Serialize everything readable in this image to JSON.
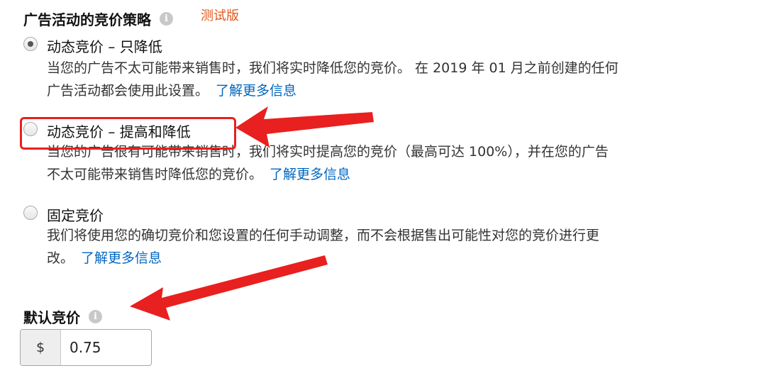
{
  "strategy": {
    "title": "广告活动的竞价策略",
    "info_icon": "info-icon",
    "test_tag": "测试版",
    "options": [
      {
        "label": "动态竞价 – 只降低",
        "checked": true,
        "desc_line1": "当您的广告不太可能带来销售时，我们将实时降低您的竞价。 在 2019 年 01 月之前创建的任何",
        "desc_line2": "广告活动都会使用此设置。",
        "link": "了解更多信息"
      },
      {
        "label": "动态竞价 – 提高和降低",
        "checked": false,
        "desc_line1": "当您的广告很有可能带来销售时，我们将实时提高您的竞价（最高可达 100%），并在您的广告",
        "desc_line2": "不太可能带来销售时降低您的竞价。",
        "link": "了解更多信息"
      },
      {
        "label": "固定竞价",
        "checked": false,
        "desc_line1": "我们将使用您的确切竞价和您设置的任何手动调整，而不会根据售出可能性对您的竞价进行更",
        "desc_line2": "改。",
        "link": "了解更多信息"
      }
    ]
  },
  "default_bid": {
    "title": "默认竞价",
    "currency": "$",
    "value": "0.75"
  },
  "annotation_color": "#e8201f"
}
